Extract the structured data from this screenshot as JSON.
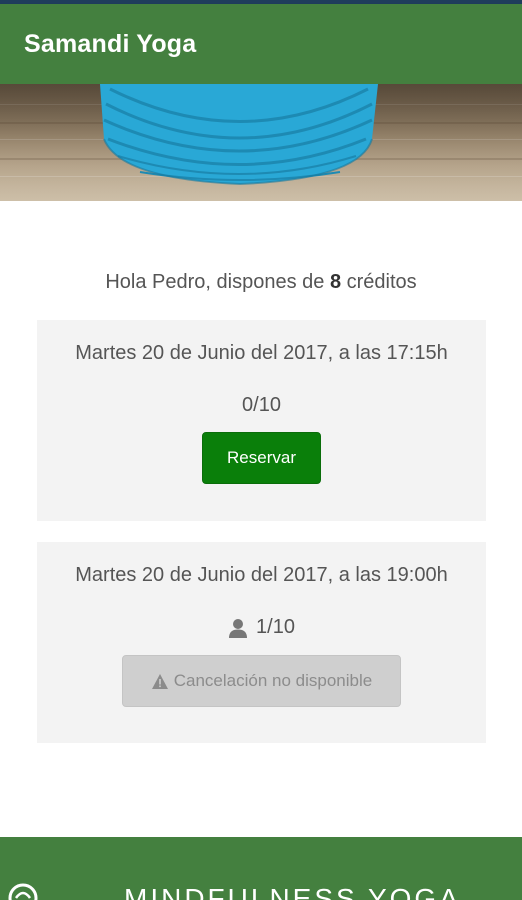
{
  "app_bar": {
    "title": "Samandi Yoga"
  },
  "hero": {
    "image": "rolled-blue-yoga-mat-on-wood",
    "mat_color": "#29a8d6"
  },
  "greeting": {
    "prefix": "Hola Pedro, dispones de ",
    "credits": "8",
    "suffix": " créditos"
  },
  "classes": [
    {
      "date": "Martes 20 de Junio del 2017, a las 17:15h",
      "occupancy": "0/10",
      "action_label": "Reservar",
      "action_enabled": true
    },
    {
      "date": "Martes 20 de Junio del 2017, a las 19:00h",
      "occupancy": "1/10",
      "occupancy_icon": "person-icon",
      "action_label": "Cancelación no disponible",
      "action_icon": "warning-icon",
      "action_enabled": false
    }
  ],
  "footer": {
    "text": "MINDFULNESS YOGA",
    "logo_icon": "lotus-logo-icon"
  },
  "colors": {
    "primary": "#44803f",
    "reserve_button": "#0a7f0a",
    "disabled_button": "#cfcfcf",
    "card_bg": "#f3f3f3"
  }
}
